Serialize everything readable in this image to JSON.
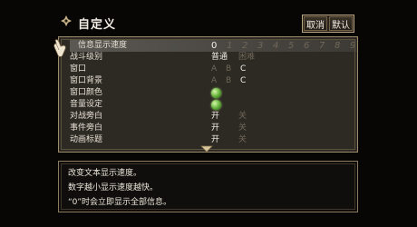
{
  "header": {
    "title": "自定义",
    "icon": "fleur-icon",
    "buttons": {
      "cancel": "取消",
      "default": "默认"
    }
  },
  "settings": {
    "text_speed": {
      "label": "信息显示速度",
      "values": [
        "0",
        "1",
        "2",
        "3",
        "4",
        "5",
        "6",
        "7",
        "8",
        "9"
      ],
      "selected": "0"
    },
    "battle_level": {
      "label": "战斗级别",
      "options": [
        "普通",
        "困难"
      ],
      "selected": "普通"
    },
    "window": {
      "label": "窗口",
      "options": [
        "A",
        "B",
        "C"
      ],
      "selected": "C"
    },
    "window_bg": {
      "label": "窗口背景",
      "options": [
        "A",
        "B",
        "C"
      ],
      "selected": "C"
    },
    "window_color": {
      "label": "窗口颜色"
    },
    "sound": {
      "label": "音量设定"
    },
    "battle_voice": {
      "label": "对战旁白",
      "options": [
        "开",
        "关"
      ],
      "selected": "开"
    },
    "event_voice": {
      "label": "事件旁白",
      "options": [
        "开",
        "关"
      ],
      "selected": "开"
    },
    "anim_title": {
      "label": "动画标题",
      "options": [
        "开",
        "关"
      ],
      "selected": "开"
    }
  },
  "description": {
    "lines": [
      "改变文本显示速度。",
      "数字越小显示速度越快。",
      "“0”时会立即显示全部信息。"
    ]
  },
  "colors": {
    "accent_gold": "#bba683",
    "gem_green": "#5fae36",
    "panel_bg": "#2d2a24"
  }
}
